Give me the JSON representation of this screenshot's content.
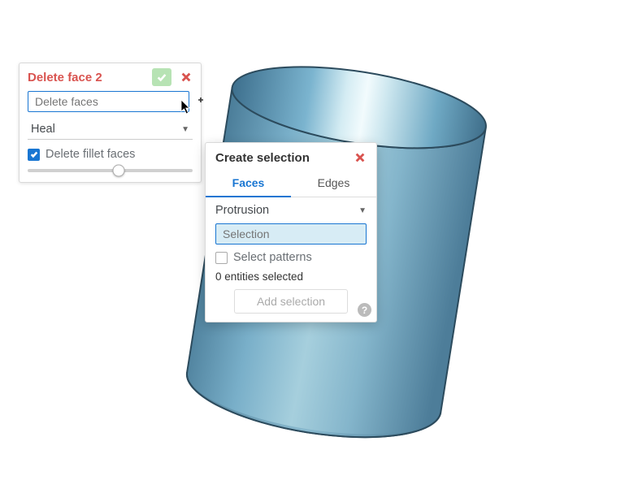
{
  "delete_panel": {
    "title": "Delete face 2",
    "faces_placeholder": "Delete faces",
    "method": "Heal",
    "delete_fillet_label": "Delete fillet faces",
    "slider_value": 55
  },
  "create_panel": {
    "title": "Create selection",
    "tabs": {
      "faces": "Faces",
      "edges": "Edges"
    },
    "protrusion_label": "Protrusion",
    "selection_placeholder": "Selection",
    "select_patterns_label": "Select patterns",
    "entities_text": "0 entities selected",
    "add_selection_label": "Add selection"
  }
}
